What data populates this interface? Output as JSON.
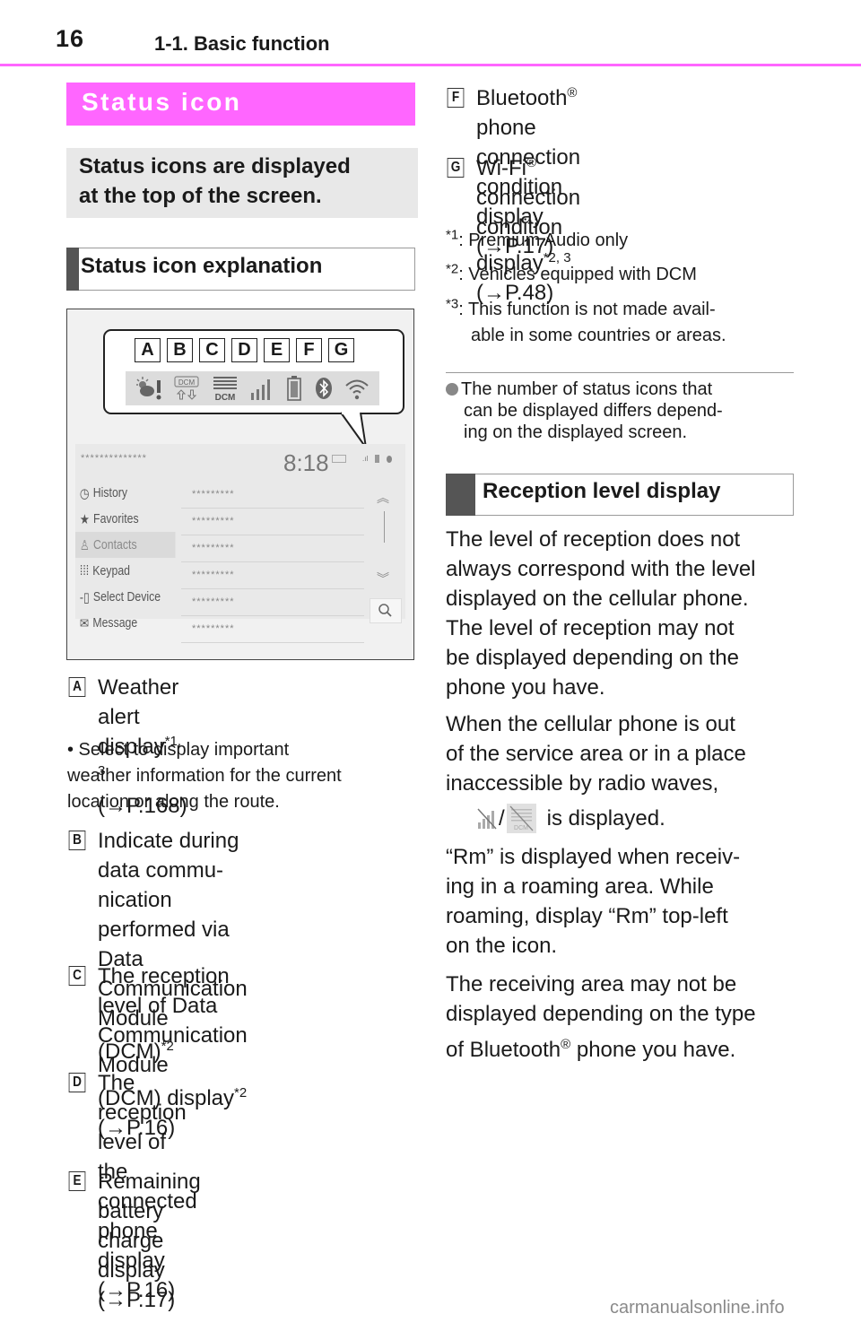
{
  "header": {
    "page_number": "16",
    "section": "1-1. Basic function",
    "rule_color": "#ff66ff"
  },
  "left": {
    "title": "Status icon",
    "intro": [
      "Status icons are displayed",
      "at the top of the screen."
    ],
    "subheading": "Status icon explanation",
    "figure": {
      "letters": [
        "A",
        "B",
        "C",
        "D",
        "E",
        "F",
        "G"
      ],
      "icons": [
        "weather-alert-icon",
        "dcm-data-transfer-icon",
        "dcm-reception-icon",
        "phone-signal-icon",
        "battery-icon",
        "bluetooth-icon",
        "wifi-icon"
      ],
      "dcm_label": "DCM",
      "screen": {
        "title_masked": "**************",
        "clock": "8:18",
        "menu": [
          "History",
          "Favorites",
          "Contacts",
          "Keypad",
          "Select Device",
          "Message"
        ],
        "active_menu": "Contacts",
        "rows": [
          "*********",
          "*********",
          "*********",
          "*********",
          "*********",
          "*********"
        ]
      }
    },
    "items": [
      {
        "label": "A",
        "lines": [
          "Weather alert display",
          "(→P.168)"
        ],
        "sup": "*1, 3",
        "note": [
          "• Select to display important",
          "weather information for the current",
          "location or along the route."
        ]
      },
      {
        "label": "B",
        "lines": [
          "Indicate during data commu-",
          "nication performed via Data",
          "Communication Module",
          "(DCM)"
        ],
        "sup": "*2"
      },
      {
        "label": "C",
        "lines": [
          "The reception level of Data",
          "Communication Module",
          "(DCM) display",
          " (→P.16)"
        ],
        "sup": "*2"
      },
      {
        "label": "D",
        "lines": [
          "The reception level of the",
          "connected phone display",
          "(→P.16)"
        ]
      },
      {
        "label": "E",
        "lines": [
          "Remaining battery charge",
          "display (→P.17)"
        ]
      }
    ]
  },
  "right": {
    "items": [
      {
        "label": "F",
        "line1a": "Bluetooth",
        "reg": "®",
        "line1b": " phone connection",
        "line2": "condition display (→P.17)"
      },
      {
        "label": "G",
        "line1a": "Wi-Fi",
        "reg": "®",
        "line1b": " connection condition",
        "line2a": "display",
        "sup": "*2, 3",
        "line2b": " (→P.48)"
      }
    ],
    "footnotes": [
      {
        "mark": "*1",
        "text": ": Premium Audio only"
      },
      {
        "mark": "*2",
        "text": ": Vehicles equipped with DCM"
      },
      {
        "mark": "*3",
        "text": ": This function is not made avail-",
        "cont": "able in some countries or areas."
      }
    ],
    "note": [
      "The number of status icons that",
      "can be displayed differs depend-",
      "ing on the displayed screen."
    ],
    "subheading": "Reception level display",
    "para1": [
      "The level of reception does not",
      "always correspond with the level",
      "displayed on the cellular phone.",
      "The level of reception may not",
      "be displayed depending on the",
      "phone you have."
    ],
    "para2": [
      "When the cellular phone is out",
      "of the service area or in a place",
      "inaccessible by radio waves,"
    ],
    "para2_tail": "is displayed.",
    "slash": "/",
    "para3": [
      "“Rm” is displayed when receiv-",
      "ing in a roaming area. While",
      "roaming, display “Rm” top-left",
      "on the icon."
    ],
    "para4": [
      "The receiving area may not be",
      "displayed depending on the type"
    ],
    "para4_last_a": "of Bluetooth",
    "para4_reg": "®",
    "para4_last_b": " phone you have."
  },
  "watermark": "carmanualsonline.info"
}
